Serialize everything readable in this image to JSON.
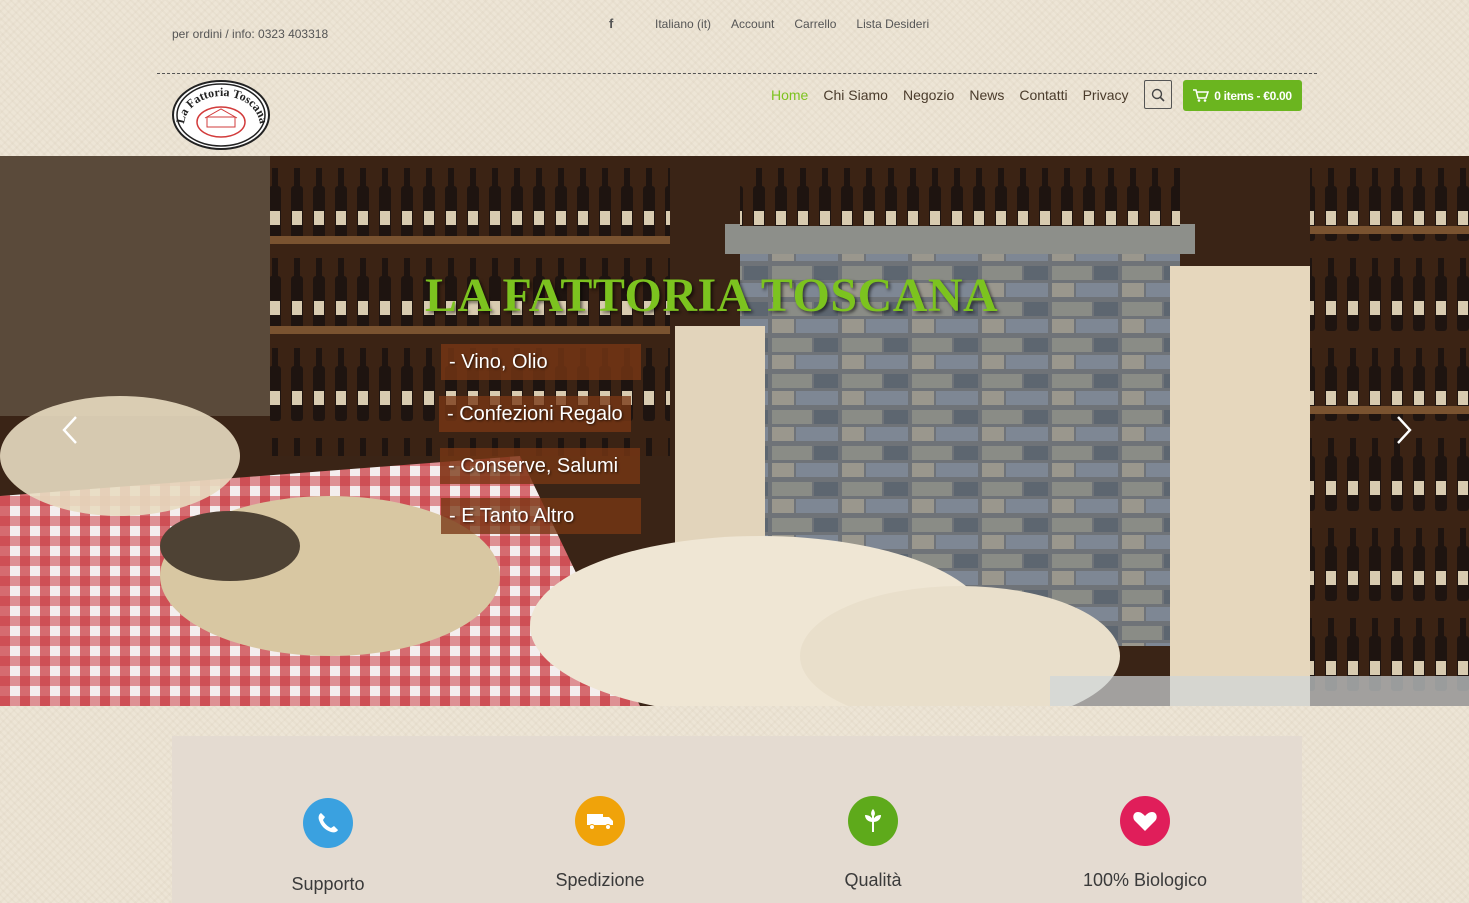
{
  "topbar": {
    "phone": "per ordini / info: 0323 403318",
    "facebook_icon": "facebook-icon",
    "facebook_glyph": "f",
    "links": [
      "Italiano (it)",
      "Account",
      "Carrello",
      "Lista Desideri"
    ]
  },
  "logo": {
    "text": "La Fattoria Toscana"
  },
  "nav": {
    "items": [
      "Home",
      "Chi Siamo",
      "Negozio",
      "News",
      "Contatti",
      "Privacy"
    ],
    "active": "Home",
    "search_icon": "search-icon",
    "cart_label": "0 items - €0.00",
    "cart_icon": "cart-icon"
  },
  "hero": {
    "title": "LA FATTORIA TOSCANA",
    "tags": [
      "- Vino, Olio",
      "- Confezioni Regalo",
      "- Conserve, Salumi",
      "- E Tanto Altro"
    ],
    "prev_icon": "chevron-left-icon",
    "next_icon": "chevron-right-icon"
  },
  "features": [
    {
      "label": "Supporto",
      "icon": "phone-icon",
      "color": "#3aa1e0"
    },
    {
      "label": "Spedizione",
      "icon": "truck-icon",
      "color": "#f0a30a"
    },
    {
      "label": "Qualità",
      "icon": "leaf-icon",
      "color": "#5eaa1b"
    },
    {
      "label": "100% Biologico",
      "icon": "heart-icon",
      "color": "#e01e5a"
    }
  ],
  "colors": {
    "accent": "#7cc31f",
    "cart": "#6bb51f",
    "tag_bg": "#783714"
  }
}
